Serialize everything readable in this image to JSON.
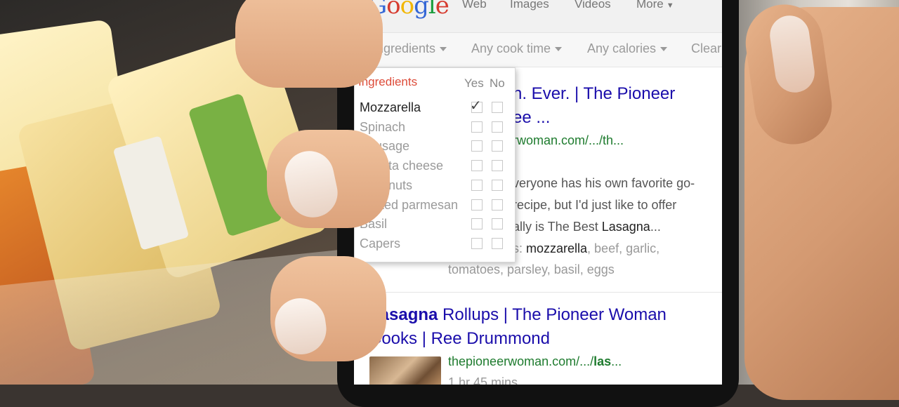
{
  "header": {
    "logo": [
      "G",
      "o",
      "o",
      "g",
      "l",
      "e"
    ],
    "tabs": [
      "Web",
      "Images",
      "Videos",
      "More"
    ]
  },
  "filters": {
    "ingredients": "Ingredients",
    "cook_time": "Any cook time",
    "calories": "Any calories",
    "clear": "Clear"
  },
  "dropdown": {
    "title": "Ingredients",
    "col_yes": "Yes",
    "col_no": "No",
    "items": [
      {
        "label": "Mozzarella",
        "yes": true,
        "no": false
      },
      {
        "label": "Spinach",
        "yes": false,
        "no": false
      },
      {
        "label": "Sausage",
        "yes": false,
        "no": false
      },
      {
        "label": "Ricotta cheese",
        "yes": false,
        "no": false
      },
      {
        "label": "Pine nuts",
        "yes": false,
        "no": false
      },
      {
        "label": "Grated parmesan",
        "yes": false,
        "no": false
      },
      {
        "label": "Basil",
        "yes": false,
        "no": false
      },
      {
        "label": "Capers",
        "yes": false,
        "no": false
      }
    ]
  },
  "results": [
    {
      "title_line1": "n. Ever. | The Pioneer",
      "title_line2": "ee ...",
      "url": "rwoman.com/.../th...",
      "snippet_1": "veryone has his own favorite go-",
      "snippet_2": "recipe, but I'd just like to offer",
      "snippet_3_pre": "ally is The Best ",
      "snippet_3_bold": "Lasagna",
      "snippet_3_post": "...",
      "ingredients_pre": "s: ",
      "ingredients_bold": "mozzarella",
      "ingredients_rest": ", beef, garlic,",
      "ingredients_line2": "tomatoes, parsley, basil, eggs"
    },
    {
      "title_bold": "Lasagna",
      "title_rest": " Rollups | The Pioneer Woman",
      "title_line2": "Cooks | Ree Drummond",
      "url_pre": "thepioneerwoman.com/.../",
      "url_bold": "las",
      "url_post": "...",
      "meta": "1 hr 45 mins"
    }
  ],
  "colors": {
    "result_title": "#1a0dab",
    "result_url": "#1e7b2e",
    "dropdown_title": "#dd4b39"
  }
}
